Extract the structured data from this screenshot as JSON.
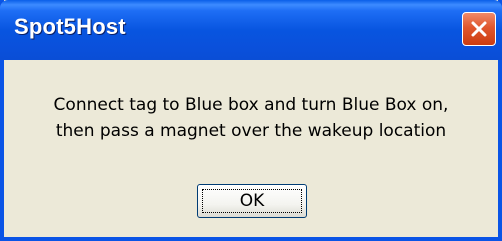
{
  "window": {
    "title": "Spot5Host"
  },
  "dialog": {
    "message_line1": "Connect tag to Blue box and turn Blue Box on,",
    "message_line2": "then pass a magnet over the wakeup location",
    "ok_label": "OK"
  },
  "icons": {
    "close": "close-icon"
  },
  "colors": {
    "titlebar": "#0a54e6",
    "close_button": "#e0572e",
    "dialog_background": "#ece9d8"
  }
}
